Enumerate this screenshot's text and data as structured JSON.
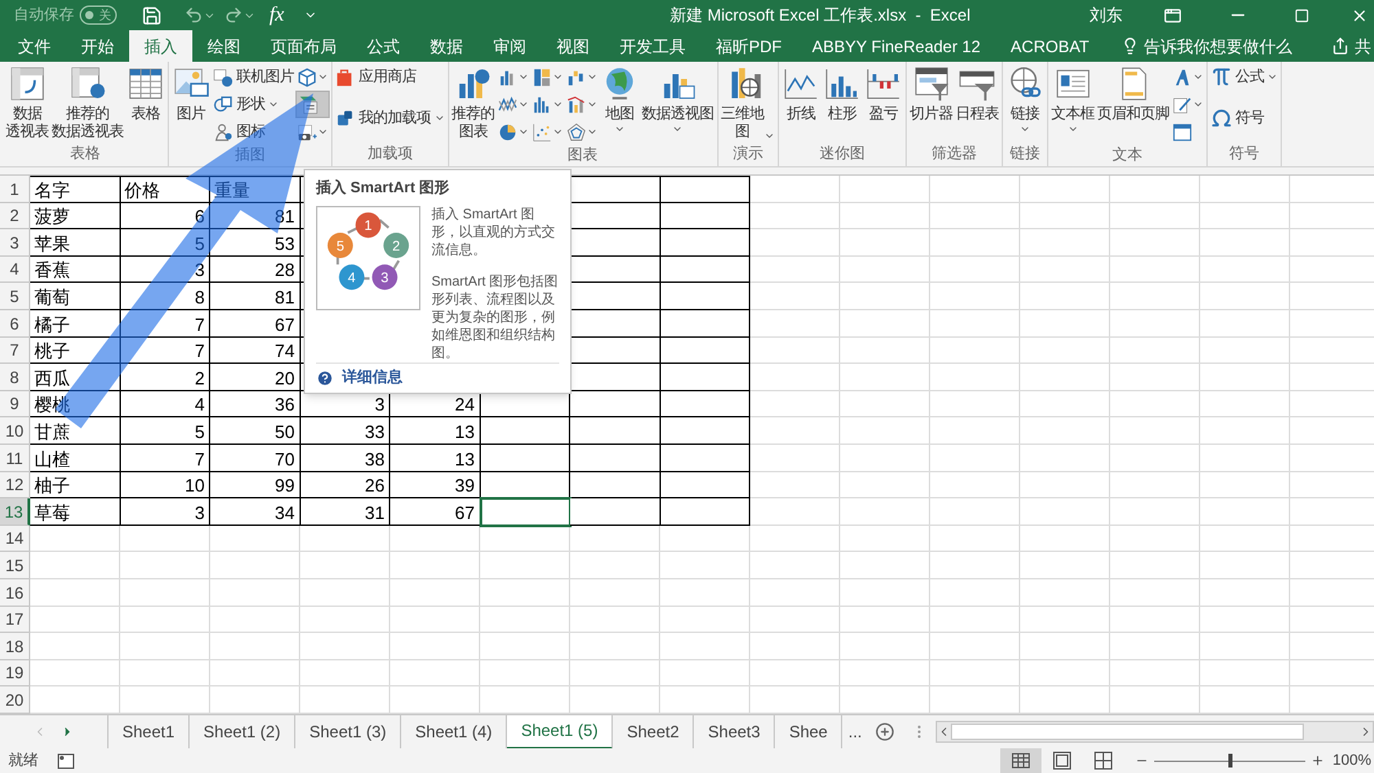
{
  "title_bar": {
    "autosave": {
      "label": "自动保存",
      "on": false,
      "state": "关"
    },
    "formula_symbol": "fx",
    "title": "新建 Microsoft Excel 工作表.xlsx  -  Excel",
    "user": "刘东"
  },
  "tabs": [
    {
      "label": "文件",
      "selected": false
    },
    {
      "label": "开始",
      "selected": false
    },
    {
      "label": "插入",
      "selected": true
    },
    {
      "label": "绘图",
      "selected": false
    },
    {
      "label": "页面布局",
      "selected": false
    },
    {
      "label": "公式",
      "selected": false
    },
    {
      "label": "数据",
      "selected": false
    },
    {
      "label": "审阅",
      "selected": false
    },
    {
      "label": "视图",
      "selected": false
    },
    {
      "label": "开发工具",
      "selected": false
    },
    {
      "label": "福昕PDF",
      "selected": false
    },
    {
      "label": "ABBYY FineReader 12",
      "selected": false
    },
    {
      "label": "ACROBAT",
      "selected": false
    }
  ],
  "tell_me": {
    "placeholder": "告诉我你想要做什么"
  },
  "share": {
    "label": "共"
  },
  "ribbon": {
    "groups": [
      {
        "label": "表格",
        "columns": [
          [
            {
              "kind": "large",
              "lines": [
                "数据",
                "透视表"
              ]
            }
          ],
          [
            {
              "kind": "large",
              "lines": [
                "推荐的",
                "数据透视表"
              ]
            }
          ],
          [
            {
              "kind": "large",
              "lines": [
                "表格"
              ]
            }
          ]
        ]
      },
      {
        "label": "插图",
        "columns": [
          [
            {
              "kind": "large",
              "lines": [
                "图片"
              ]
            }
          ],
          [
            {
              "kind": "small",
              "label": "联机图片",
              "dropdown": false
            },
            {
              "kind": "small",
              "label": "形状",
              "dropdown": true
            },
            {
              "kind": "small",
              "label": "图标",
              "dropdown": false
            }
          ],
          [
            {
              "kind": "icon",
              "dropdown": true,
              "hovered": false
            },
            {
              "kind": "icon",
              "dropdown": false,
              "hovered": true
            },
            {
              "kind": "icon",
              "dropdown": true,
              "hovered": false
            }
          ]
        ]
      },
      {
        "label": "加载项",
        "columns": [
          [
            {
              "kind": "small",
              "label": "应用商店",
              "dropdown": false
            },
            {
              "kind": "small",
              "label": "我的加载项",
              "dropdown": true
            }
          ]
        ]
      },
      {
        "label": "图表",
        "columns": [
          [
            {
              "kind": "large",
              "lines": [
                "推荐的",
                "图表"
              ]
            }
          ],
          [
            {
              "kind": "icon",
              "dropdown": true,
              "hovered": false
            },
            {
              "kind": "icon",
              "dropdown": true,
              "hovered": false
            },
            {
              "kind": "icon",
              "dropdown": true,
              "hovered": false
            }
          ],
          [
            {
              "kind": "icon",
              "dropdown": true,
              "hovered": false
            },
            {
              "kind": "icon",
              "dropdown": true,
              "hovered": false
            },
            {
              "kind": "icon",
              "dropdown": true,
              "hovered": false
            }
          ],
          [
            {
              "kind": "icon",
              "dropdown": true,
              "hovered": false
            },
            {
              "kind": "icon",
              "dropdown": true,
              "hovered": false
            },
            {
              "kind": "icon",
              "dropdown": true,
              "hovered": false
            }
          ],
          [
            {
              "kind": "large",
              "lines": [
                "地图"
              ],
              "dropdown": true
            }
          ],
          [
            {
              "kind": "large",
              "lines": [
                "数据透视图"
              ],
              "dropdown": true
            }
          ]
        ]
      },
      {
        "label": "演示",
        "columns": [
          [
            {
              "kind": "large",
              "lines": [
                "三维地",
                "图"
              ],
              "dropdown": true
            }
          ]
        ]
      },
      {
        "label": "迷你图",
        "columns": [
          [
            {
              "kind": "large",
              "lines": [
                "折线"
              ]
            }
          ],
          [
            {
              "kind": "large",
              "lines": [
                "柱形"
              ]
            }
          ],
          [
            {
              "kind": "large",
              "lines": [
                "盈亏"
              ]
            }
          ]
        ]
      },
      {
        "label": "筛选器",
        "columns": [
          [
            {
              "kind": "large",
              "lines": [
                "切片器"
              ]
            }
          ],
          [
            {
              "kind": "large",
              "lines": [
                "日程表"
              ]
            }
          ]
        ]
      },
      {
        "label": "链接",
        "columns": [
          [
            {
              "kind": "large",
              "lines": [
                "链接"
              ],
              "dropdown": true
            }
          ]
        ]
      },
      {
        "label": "文本",
        "columns": [
          [
            {
              "kind": "large",
              "lines": [
                "文本框"
              ],
              "dropdown": true
            }
          ],
          [
            {
              "kind": "large",
              "lines": [
                "页眉和页脚"
              ]
            }
          ],
          [
            {
              "kind": "icon",
              "dropdown": true,
              "hovered": false
            },
            {
              "kind": "icon",
              "dropdown": true,
              "hovered": false
            },
            {
              "kind": "icon",
              "dropdown": false,
              "hovered": false
            }
          ]
        ]
      },
      {
        "label": "符号",
        "columns": [
          [
            {
              "kind": "small",
              "label": "公式",
              "dropdown": true
            },
            {
              "kind": "small",
              "label": "符号",
              "dropdown": false
            }
          ]
        ]
      }
    ]
  },
  "sheet": {
    "rows": [
      {
        "number": "1",
        "selected": false,
        "cells": [
          "名字",
          "价格",
          "重量"
        ]
      },
      {
        "number": "2",
        "selected": false,
        "cells": [
          "菠萝",
          "6",
          "81"
        ]
      },
      {
        "number": "3",
        "selected": false,
        "cells": [
          "苹果",
          "5",
          "53"
        ]
      },
      {
        "number": "4",
        "selected": false,
        "cells": [
          "香蕉",
          "3",
          "28"
        ]
      },
      {
        "number": "5",
        "selected": false,
        "cells": [
          "葡萄",
          "8",
          "81"
        ]
      },
      {
        "number": "6",
        "selected": false,
        "cells": [
          "橘子",
          "7",
          "67"
        ]
      },
      {
        "number": "7",
        "selected": false,
        "cells": [
          "桃子",
          "7",
          "74"
        ]
      },
      {
        "number": "8",
        "selected": false,
        "cells": [
          "西瓜",
          "2",
          "20"
        ]
      },
      {
        "number": "9",
        "selected": false,
        "cells": [
          "樱桃",
          "4",
          "36",
          "3",
          "24"
        ]
      },
      {
        "number": "10",
        "selected": false,
        "cells": [
          "甘蔗",
          "5",
          "50",
          "33",
          "13"
        ]
      },
      {
        "number": "11",
        "selected": false,
        "cells": [
          "山楂",
          "7",
          "70",
          "38",
          "13"
        ]
      },
      {
        "number": "12",
        "selected": false,
        "cells": [
          "柚子",
          "10",
          "99",
          "26",
          "39"
        ]
      },
      {
        "number": "13",
        "selected": true,
        "cells": [
          "草莓",
          "3",
          "34",
          "31",
          "67"
        ]
      },
      {
        "number": "14",
        "selected": false
      },
      {
        "number": "15",
        "selected": false
      },
      {
        "number": "16",
        "selected": false
      },
      {
        "number": "17",
        "selected": false
      },
      {
        "number": "18",
        "selected": false
      },
      {
        "number": "19",
        "selected": false
      },
      {
        "number": "20",
        "selected": false
      }
    ]
  },
  "tooltip": {
    "title": "插入 SmartArt 图形",
    "diagram": [
      {
        "label": "1",
        "color": "#d9573b"
      },
      {
        "label": "2",
        "color": "#6aa38e"
      },
      {
        "label": "3",
        "color": "#9159b5"
      },
      {
        "label": "4",
        "color": "#2e96cf"
      },
      {
        "label": "5",
        "color": "#e8883a"
      }
    ],
    "paragraphs": [
      "插入 SmartArt 图形，以直观的方式交流信息。",
      "SmartArt 图形包括图形列表、流程图以及更为复杂的图形，例如维恩图和组织结构图。"
    ],
    "link": "详细信息"
  },
  "sheet_tabs": [
    {
      "label": "Sheet1",
      "selected": false
    },
    {
      "label": "Sheet1 (2)",
      "selected": false
    },
    {
      "label": "Sheet1 (3)",
      "selected": false
    },
    {
      "label": "Sheet1 (4)",
      "selected": false
    },
    {
      "label": "Sheet1 (5)",
      "selected": true
    },
    {
      "label": "Sheet2",
      "selected": false
    },
    {
      "label": "Sheet3",
      "selected": false
    },
    {
      "label": "Shee",
      "selected": false
    }
  ],
  "more_tabs": "...",
  "status_bar": {
    "status": "就绪",
    "zoom": {
      "level": 0.5,
      "reading": "100%"
    }
  }
}
